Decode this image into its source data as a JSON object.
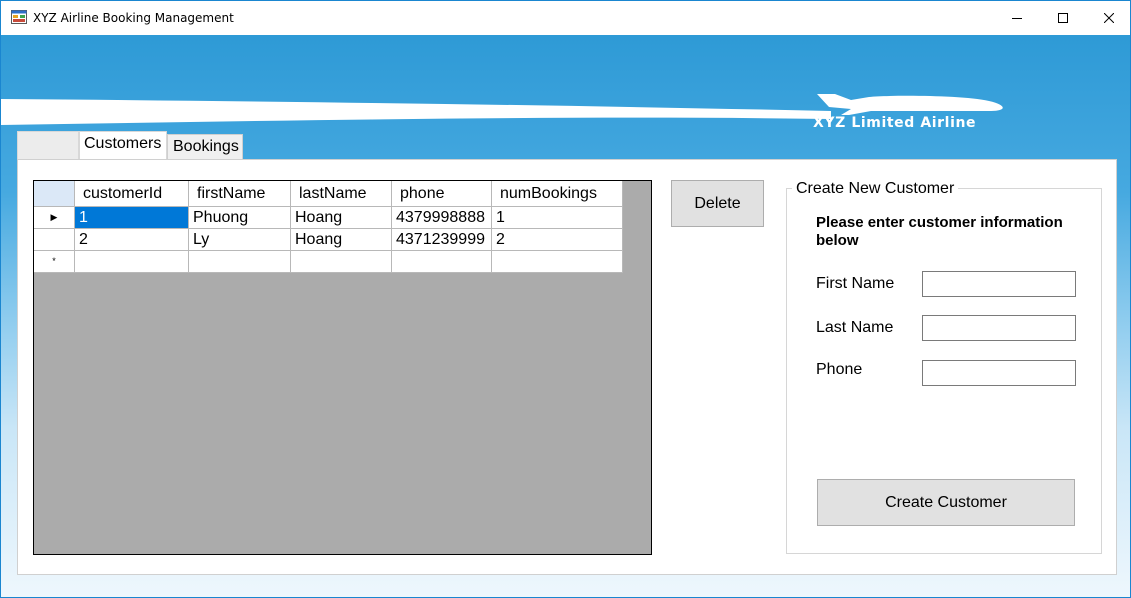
{
  "window": {
    "title": "XYZ Airline Booking Management",
    "minimize_glyph": "—",
    "maximize_glyph": "☐",
    "close_glyph": "✕"
  },
  "branding": {
    "text": "XYZ Limited Airline"
  },
  "tabs": [
    {
      "label": "Customers",
      "selected": true
    },
    {
      "label": "Bookings",
      "selected": false
    }
  ],
  "grid": {
    "columns": [
      "customerId",
      "firstName",
      "lastName",
      "phone",
      "numBookings"
    ],
    "rows": [
      {
        "indicator": "▶",
        "cells": [
          "1",
          "Phuong",
          "Hoang",
          "4379998888",
          "1"
        ]
      },
      {
        "indicator": "",
        "cells": [
          "2",
          "Ly",
          "Hoang",
          "4371239999",
          "2"
        ]
      },
      {
        "indicator": "*",
        "cells": [
          "",
          "",
          "",
          "",
          ""
        ]
      }
    ]
  },
  "actions": {
    "delete_label": "Delete"
  },
  "create_form": {
    "title": "Create New Customer",
    "instructions": "Please enter customer information below",
    "first_name_label": "First Name",
    "first_name_value": "",
    "last_name_label": "Last Name",
    "last_name_value": "",
    "phone_label": "Phone",
    "phone_value": "",
    "submit_label": "Create Customer"
  },
  "colors": {
    "accent": "#0078d7",
    "sky": "#2e9ad6",
    "grid_background": "#ababab"
  }
}
